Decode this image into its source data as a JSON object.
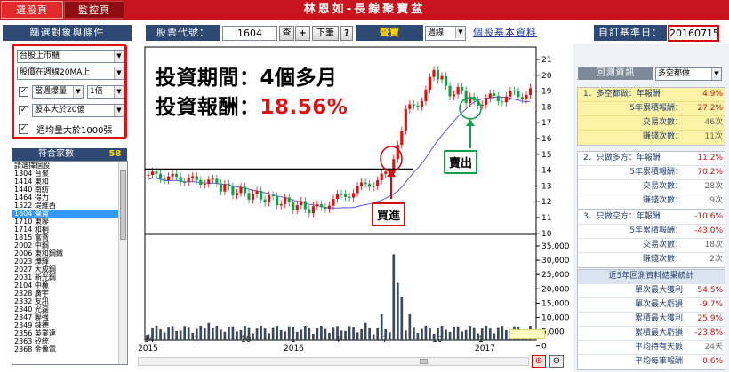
{
  "header": {
    "tabs": [
      {
        "label": "選股頁"
      },
      {
        "label": "監控頁"
      }
    ],
    "title": "林恩如-長線聚寶盆"
  },
  "toolbar": {
    "filter_title": "篩選對象與條件",
    "stock_code_label": "股票代號：",
    "stock_code_value": "1604",
    "query_btn": "查",
    "plus_btn": "+",
    "next_btn": "下筆",
    "help_btn": "?",
    "stock_name": "聲寶",
    "period_value": "週線",
    "stock_info_link": "個股基本資料",
    "base_date_label": "自訂基準日：",
    "base_date_value": "20160715"
  },
  "filters": {
    "market": "台股上市櫃",
    "condition1": "股價在週線20MA上",
    "condition2_a": "當週爆量",
    "condition2_b": "1倍",
    "condition3": "股本大於20億",
    "condition4": "週均量大於1000張"
  },
  "counts": {
    "label": "符合家數",
    "value": "58"
  },
  "stock_list": [
    "請選擇個股",
    "1304 台聚",
    "1414 東和",
    "1440 南紡",
    "1464 得力",
    "1522 堤維西",
    "1604 聲寶",
    "1710 東聯",
    "1714 和桐",
    "1815 富喬",
    "2002 中鋼",
    "2006 東和鋼鐵",
    "2023 燁輝",
    "2027 大成鋼",
    "2031 新光鋼",
    "2104 中橡",
    "2328 廣宇",
    "2332 友訊",
    "2340 光磊",
    "2347 聯強",
    "2349 錸德",
    "2356 英業達",
    "2363 矽統",
    "2368 金像電"
  ],
  "selected_stock_index": 6,
  "overlay": {
    "line1": "投資期間：4個多月",
    "line2_prefix": "投資報酬：",
    "line2_value": "18.56%",
    "buy_label": "買進",
    "sell_label": "賣出"
  },
  "backtest": {
    "title": "回測資訊",
    "mode": "多空都做",
    "sec1": [
      {
        "label": "1．多空都做：年報酬",
        "value": "4.9%",
        "color": "red"
      },
      {
        "label": "5年累積報酬：",
        "value": "27.2%",
        "color": "red"
      },
      {
        "label": "交易次數：",
        "value": "46次",
        "color": "grey"
      },
      {
        "label": "賺錢次數：",
        "value": "11次",
        "color": "grey"
      }
    ],
    "sec2": [
      {
        "label": "2．只做多方：年報酬",
        "value": "11.2%",
        "color": "red"
      },
      {
        "label": "5年累積報酬：",
        "value": "70.2%",
        "color": "red"
      },
      {
        "label": "交易次數：",
        "value": "28次",
        "color": "grey"
      },
      {
        "label": "賺錢次數：",
        "value": "9次",
        "color": "grey"
      }
    ],
    "sec3": [
      {
        "label": "3．只做空方：年報酬",
        "value": "-10.6%",
        "color": "red"
      },
      {
        "label": "5年累積報酬：",
        "value": "-43.0%",
        "color": "red"
      },
      {
        "label": "交易次數：",
        "value": "18次",
        "color": "grey"
      },
      {
        "label": "賺錢次數：",
        "value": "2次",
        "color": "grey"
      }
    ],
    "sec4_title": "近5年回測資料結果統計",
    "sec4": [
      {
        "label": "單次最大獲利",
        "value": "54.5%",
        "color": "red"
      },
      {
        "label": "單次最大虧損",
        "value": "-9.7%",
        "color": "red"
      },
      {
        "label": "累積最大獲利",
        "value": "25.9%",
        "color": "red"
      },
      {
        "label": "累積最大虧損",
        "value": "-23.8%",
        "color": "red"
      },
      {
        "label": "平均持有天數",
        "value": "24天",
        "color": "grey"
      },
      {
        "label": "平均每筆報酬",
        "value": "0.6%",
        "color": "red"
      }
    ]
  },
  "chart": {
    "price_ticks": [
      "21",
      "20",
      "19",
      "18",
      "17",
      "16",
      "15",
      "14",
      "13",
      "12",
      "11",
      "10"
    ],
    "volume_ticks": [
      "35,000",
      "30,000",
      "25,000",
      "20,000",
      "15,000",
      "10,000",
      "5,000",
      "0"
    ],
    "x_ticks": [
      "34",
      "7",
      "10",
      "1",
      "4",
      "7",
      "10",
      "1"
    ],
    "x_years": [
      "2015",
      "2016",
      "2017"
    ],
    "colors": {
      "up": "#e01010",
      "down": "#12a14a",
      "ma": "#5b5bd6",
      "volume": "#3a4a5a"
    }
  }
}
